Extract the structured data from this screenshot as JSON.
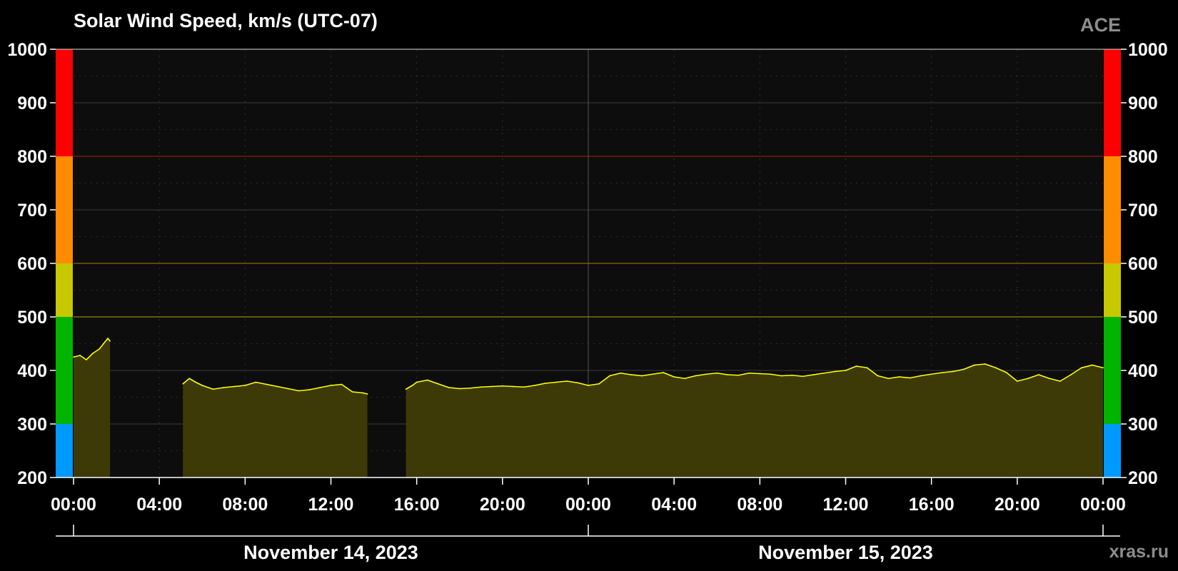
{
  "title": "Solar Wind Speed, km/s (UTC-07)",
  "source": "ACE",
  "credit": "xras.ru",
  "colors": {
    "background": "#000000",
    "plot_background": "#0d0d0d",
    "line": "#ffff00",
    "fill": "#3d3a08",
    "grid": "#444444",
    "band_blue": "#0099ff",
    "band_green": "#00b400",
    "band_yellow": "#c8c800",
    "band_orange": "#ff8c00",
    "band_red": "#ff0000"
  },
  "chart_data": {
    "type": "area",
    "title": "Solar Wind Speed, km/s (UTC-07)",
    "xlabel": "",
    "ylabel": "",
    "ylim": [
      200,
      1000
    ],
    "xlim_hours": [
      0,
      48
    ],
    "x_unit": "hours since 2023-11-14 00:00 (UTC-07)",
    "grid": true,
    "y_ticks": [
      "200",
      "300",
      "400",
      "500",
      "600",
      "700",
      "800",
      "900",
      "1000"
    ],
    "x_tick_labels": [
      "00:00",
      "04:00",
      "08:00",
      "12:00",
      "16:00",
      "20:00",
      "00:00",
      "04:00",
      "08:00",
      "12:00",
      "16:00",
      "20:00",
      "00:00"
    ],
    "date_labels": [
      "November 14, 2023",
      "November 15, 2023"
    ],
    "threshold_bands": [
      {
        "from": 200,
        "to": 300,
        "color": "#0099ff"
      },
      {
        "from": 300,
        "to": 500,
        "color": "#00b400"
      },
      {
        "from": 500,
        "to": 600,
        "color": "#c8c800"
      },
      {
        "from": 600,
        "to": 800,
        "color": "#ff8c00"
      },
      {
        "from": 800,
        "to": 1000,
        "color": "#ff0000"
      }
    ],
    "threshold_lines": [
      {
        "value": 500,
        "color": "#8a8a10"
      },
      {
        "value": 600,
        "color": "#8a6a10"
      },
      {
        "value": 800,
        "color": "#8a2010"
      }
    ],
    "series": [
      {
        "segments": [
          {
            "x": [
              0.0,
              0.3,
              0.6,
              0.9,
              1.2,
              1.4,
              1.6,
              1.7
            ],
            "y": [
              425,
              428,
              420,
              432,
              440,
              450,
              460,
              455
            ]
          },
          {
            "x": [
              5.1,
              5.4,
              5.7,
              6.0,
              6.5,
              7.0,
              7.5,
              8.0,
              8.5,
              9.0,
              9.5,
              10.0,
              10.5,
              11.0,
              11.5,
              12.0,
              12.5,
              13.0,
              13.5,
              13.7
            ],
            "y": [
              375,
              385,
              378,
              372,
              365,
              368,
              370,
              372,
              378,
              374,
              370,
              366,
              362,
              364,
              368,
              372,
              374,
              360,
              358,
              356
            ]
          },
          {
            "x": [
              15.5,
              15.8,
              16.0,
              16.5,
              17.0,
              17.5,
              18.0,
              18.5,
              19.0,
              19.5,
              20.0,
              20.5,
              21.0,
              21.5,
              22.0,
              22.5,
              23.0,
              23.5,
              24.0,
              24.5,
              25.0,
              25.5,
              26.0,
              26.5,
              27.0,
              27.5,
              28.0,
              28.5,
              29.0,
              29.5,
              30.0,
              30.5,
              31.0,
              31.5,
              32.0,
              32.5,
              33.0,
              33.5,
              34.0,
              34.5,
              35.0,
              35.5,
              36.0,
              36.5,
              37.0,
              37.5,
              38.0,
              38.5,
              39.0,
              39.5,
              40.0,
              40.5,
              41.0,
              41.5,
              42.0,
              42.5,
              43.0,
              43.5,
              44.0,
              44.5,
              45.0,
              45.5,
              46.0,
              46.5,
              47.0,
              47.5,
              48.0
            ],
            "y": [
              365,
              372,
              378,
              382,
              375,
              368,
              366,
              367,
              369,
              370,
              371,
              370,
              369,
              372,
              376,
              378,
              380,
              377,
              372,
              375,
              390,
              395,
              392,
              390,
              393,
              396,
              388,
              385,
              390,
              393,
              395,
              392,
              391,
              395,
              394,
              393,
              390,
              391,
              389,
              392,
              395,
              398,
              400,
              408,
              405,
              390,
              385,
              388,
              386,
              390,
              393,
              396,
              398,
              402,
              410,
              412,
              405,
              396,
              380,
              385,
              392,
              385,
              380,
              392,
              405,
              410,
              405
            ]
          }
        ]
      }
    ]
  }
}
